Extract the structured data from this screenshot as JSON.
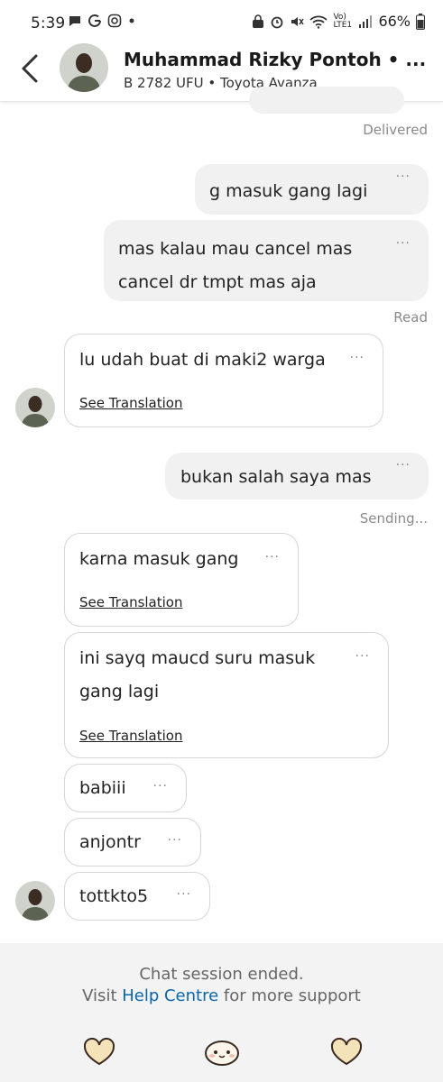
{
  "status_bar": {
    "time": "5:39",
    "battery": "66%",
    "network": "Vo) LTE1"
  },
  "header": {
    "name": "Muhammad Rizky Pontoh • ...",
    "subtitle": "B 2782 UFU • Toyota Avanza"
  },
  "dots": "···",
  "messages": [
    {
      "text": "g masuk gang lagi"
    },
    {
      "text_line1": "mas kalau mau cancel mas",
      "text_line2": "cancel dr tmpt mas aja"
    },
    {
      "text": "lu udah buat di maki2 warga",
      "translate": "See Translation"
    },
    {
      "text": "bukan salah saya mas"
    },
    {
      "text": "karna masuk gang",
      "translate": "See Translation"
    },
    {
      "text_line1": "ini sayq maucd suru masuk",
      "text_line2": "gang lagi",
      "translate": "See Translation"
    },
    {
      "text": "babiii"
    },
    {
      "text": "anjontr"
    },
    {
      "text": "tottkto5"
    }
  ],
  "statuses": {
    "delivered": "Delivered",
    "read": "Read",
    "sending": "Sending..."
  },
  "footer": {
    "line1": "Chat session ended.",
    "line2_pre": "Visit",
    "link": "Help Centre",
    "line2_post": "for more support"
  },
  "colors": {
    "link": "#0a66a8",
    "outgoing_bubble": "#f1f1f1",
    "incoming_border": "#d6d6d6"
  }
}
